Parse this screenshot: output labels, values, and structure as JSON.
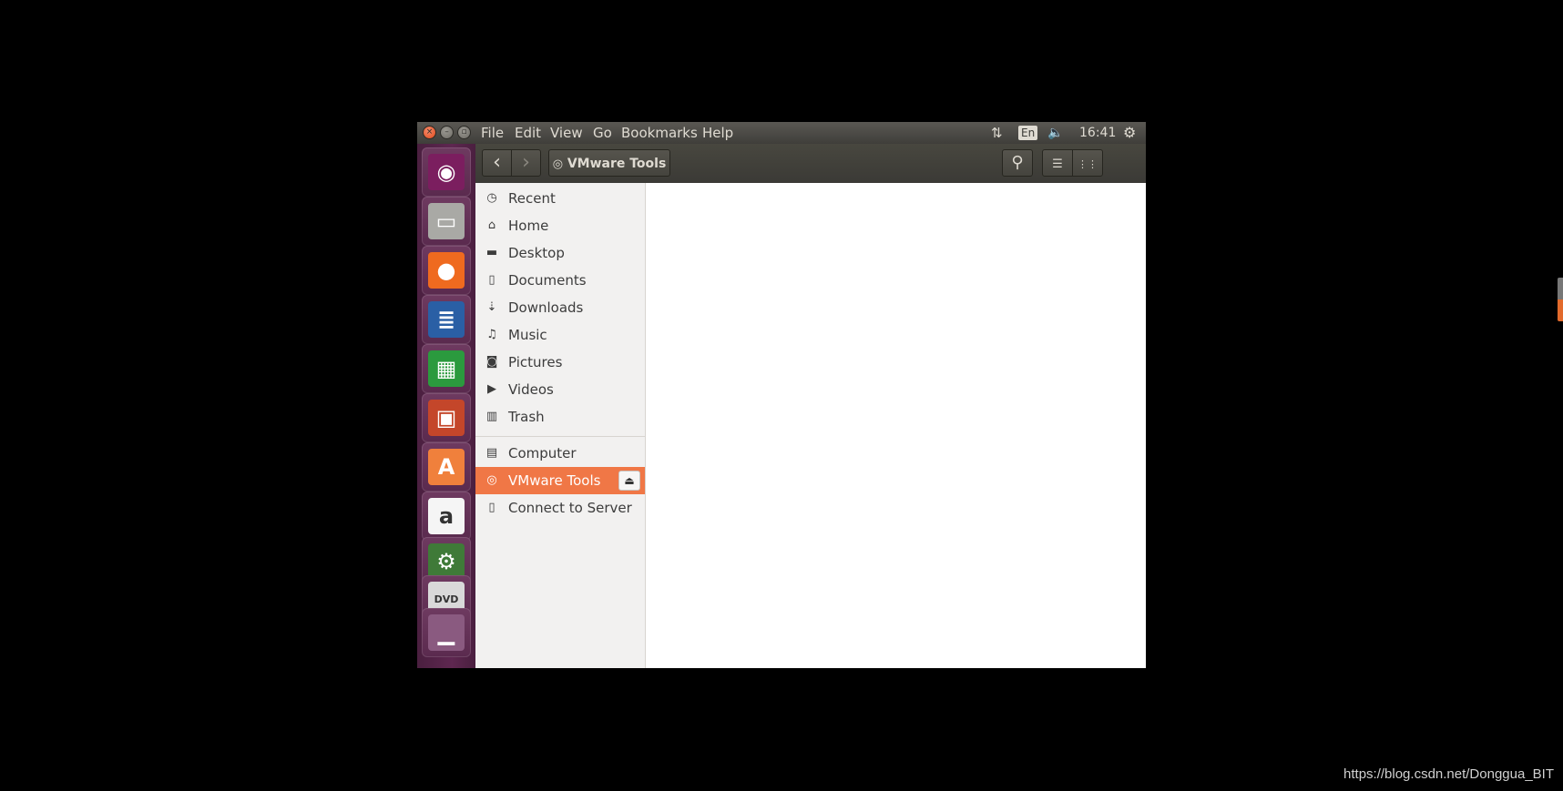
{
  "window": {
    "menus": [
      "File",
      "Edit",
      "View",
      "Go",
      "Bookmarks",
      "Help"
    ],
    "close_glyph": "×",
    "min_glyph": "–",
    "max_glyph": "▫",
    "indicators": {
      "network_icon": "⇅",
      "language": "En",
      "sound_icon": "🔈",
      "time": "16:41",
      "settings_icon": "⚙"
    }
  },
  "launcher": {
    "items": [
      {
        "name": "ubuntu-dash-icon",
        "glyph": "◉",
        "color": "#7b1e5f"
      },
      {
        "name": "files-icon",
        "glyph": "▭",
        "color": "#a9a9a5"
      },
      {
        "name": "firefox-icon",
        "glyph": "●",
        "color": "#ef6a1f"
      },
      {
        "name": "writer-icon",
        "glyph": "≣",
        "color": "#2a5fa5"
      },
      {
        "name": "calc-icon",
        "glyph": "▦",
        "color": "#2b9a3e"
      },
      {
        "name": "impress-icon",
        "glyph": "▣",
        "color": "#c4462a"
      },
      {
        "name": "software-center-icon",
        "glyph": "A",
        "color": "#f0803c"
      },
      {
        "name": "amazon-icon",
        "glyph": "a",
        "color": "#f5f5f5"
      },
      {
        "name": "system-settings-icon",
        "glyph": "⚙",
        "color": "#3f7a38"
      },
      {
        "name": "dvd-icon",
        "glyph": "DVD",
        "color": "#d9d9d9"
      },
      {
        "name": "trash-icon",
        "glyph": "▁",
        "color": "#8a5a80"
      }
    ]
  },
  "toolbar": {
    "back_glyph": "‹",
    "forward_glyph": "›",
    "path_icon": "◎",
    "path_label": "VMware Tools",
    "search_glyph": "⚲",
    "list_view_glyph": "☰",
    "grid_view_glyph": "⋮⋮"
  },
  "sidebar": {
    "places": [
      {
        "label": "Recent",
        "icon": "◷"
      },
      {
        "label": "Home",
        "icon": "⌂"
      },
      {
        "label": "Desktop",
        "icon": "▬"
      },
      {
        "label": "Documents",
        "icon": "▯"
      },
      {
        "label": "Downloads",
        "icon": "⇣"
      },
      {
        "label": "Music",
        "icon": "♫"
      },
      {
        "label": "Pictures",
        "icon": "◙"
      },
      {
        "label": "Videos",
        "icon": "▶"
      },
      {
        "label": "Trash",
        "icon": "▥"
      }
    ],
    "devices": [
      {
        "label": "Computer",
        "icon": "▤",
        "active": false
      },
      {
        "label": "VMware Tools",
        "icon": "◎",
        "active": true
      },
      {
        "label": "Connect to Server",
        "icon": "▯",
        "active": false
      }
    ],
    "eject_glyph": "⏏"
  },
  "watermark": "https://blog.csdn.net/Donggua_BIT"
}
